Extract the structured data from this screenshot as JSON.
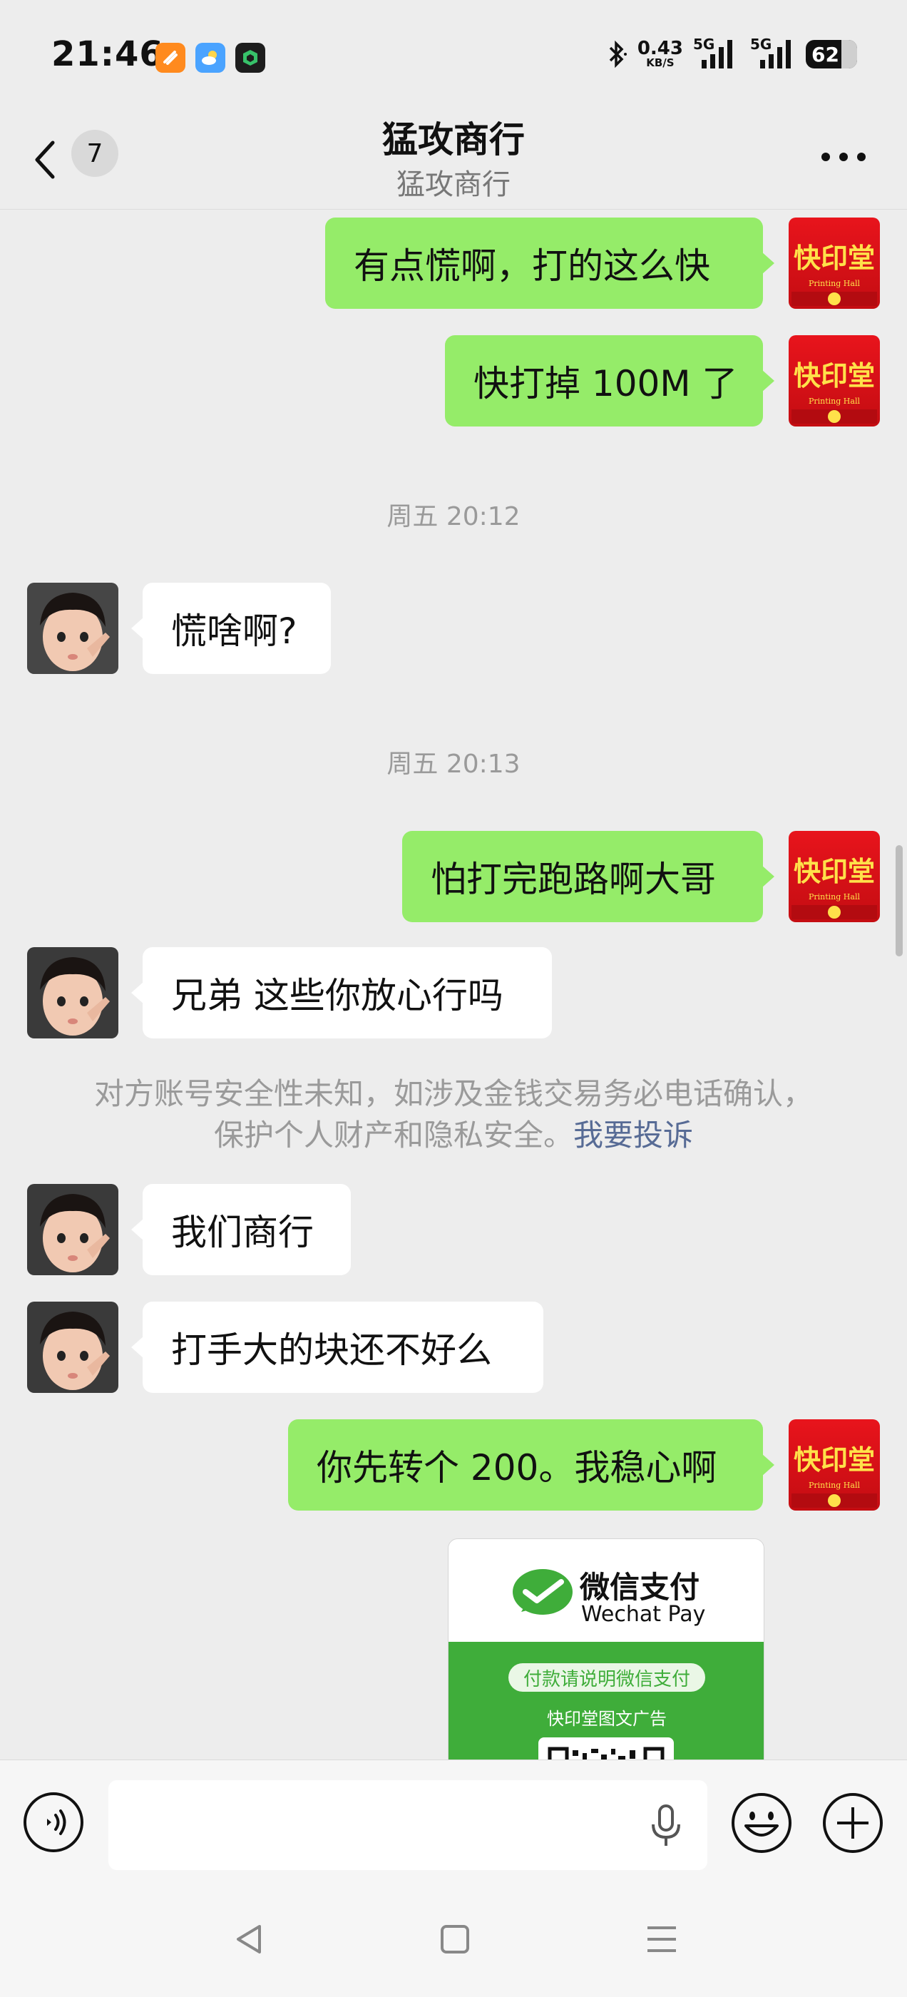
{
  "status_bar": {
    "time": "21:46",
    "net_speed": "0.43",
    "net_unit": "KB/S",
    "signal_1": "5G",
    "signal_2": "5G",
    "battery": "62"
  },
  "header": {
    "unread_count": "7",
    "title": "猛攻商行",
    "subtitle": "猛攻商行"
  },
  "messages": {
    "m1": "有点慌啊，打的这么快",
    "m2": "快打掉 100M 了",
    "t1": "周五 20:12",
    "m3": "慌啥啊?",
    "t2": "周五 20:13",
    "m4": "怕打完跑路啊大哥",
    "m5": "兄弟 这些你放心行吗",
    "notice_line1": "对方账号安全性未知，如涉及金钱交易务必电话确认，",
    "notice_line2": "保护个人财产和隐私安全。",
    "notice_link": "我要投诉",
    "m6": "我们商行",
    "m7": "打手大的块还不好么",
    "m8": "你先转个 200。我稳心啊"
  },
  "avatar_brand": {
    "text": "快印堂",
    "caption": "Printing Hall"
  },
  "pay_card": {
    "title": "微信支付",
    "subtitle": "Wechat Pay",
    "pill": "付款请说明微信支付",
    "merchant": "快印堂图文广告"
  },
  "colors": {
    "outgoing_bubble": "#95ec69",
    "incoming_bubble": "#ffffff",
    "background": "#ededed",
    "link": "#576b95",
    "wechat_green": "#3fad3a"
  }
}
